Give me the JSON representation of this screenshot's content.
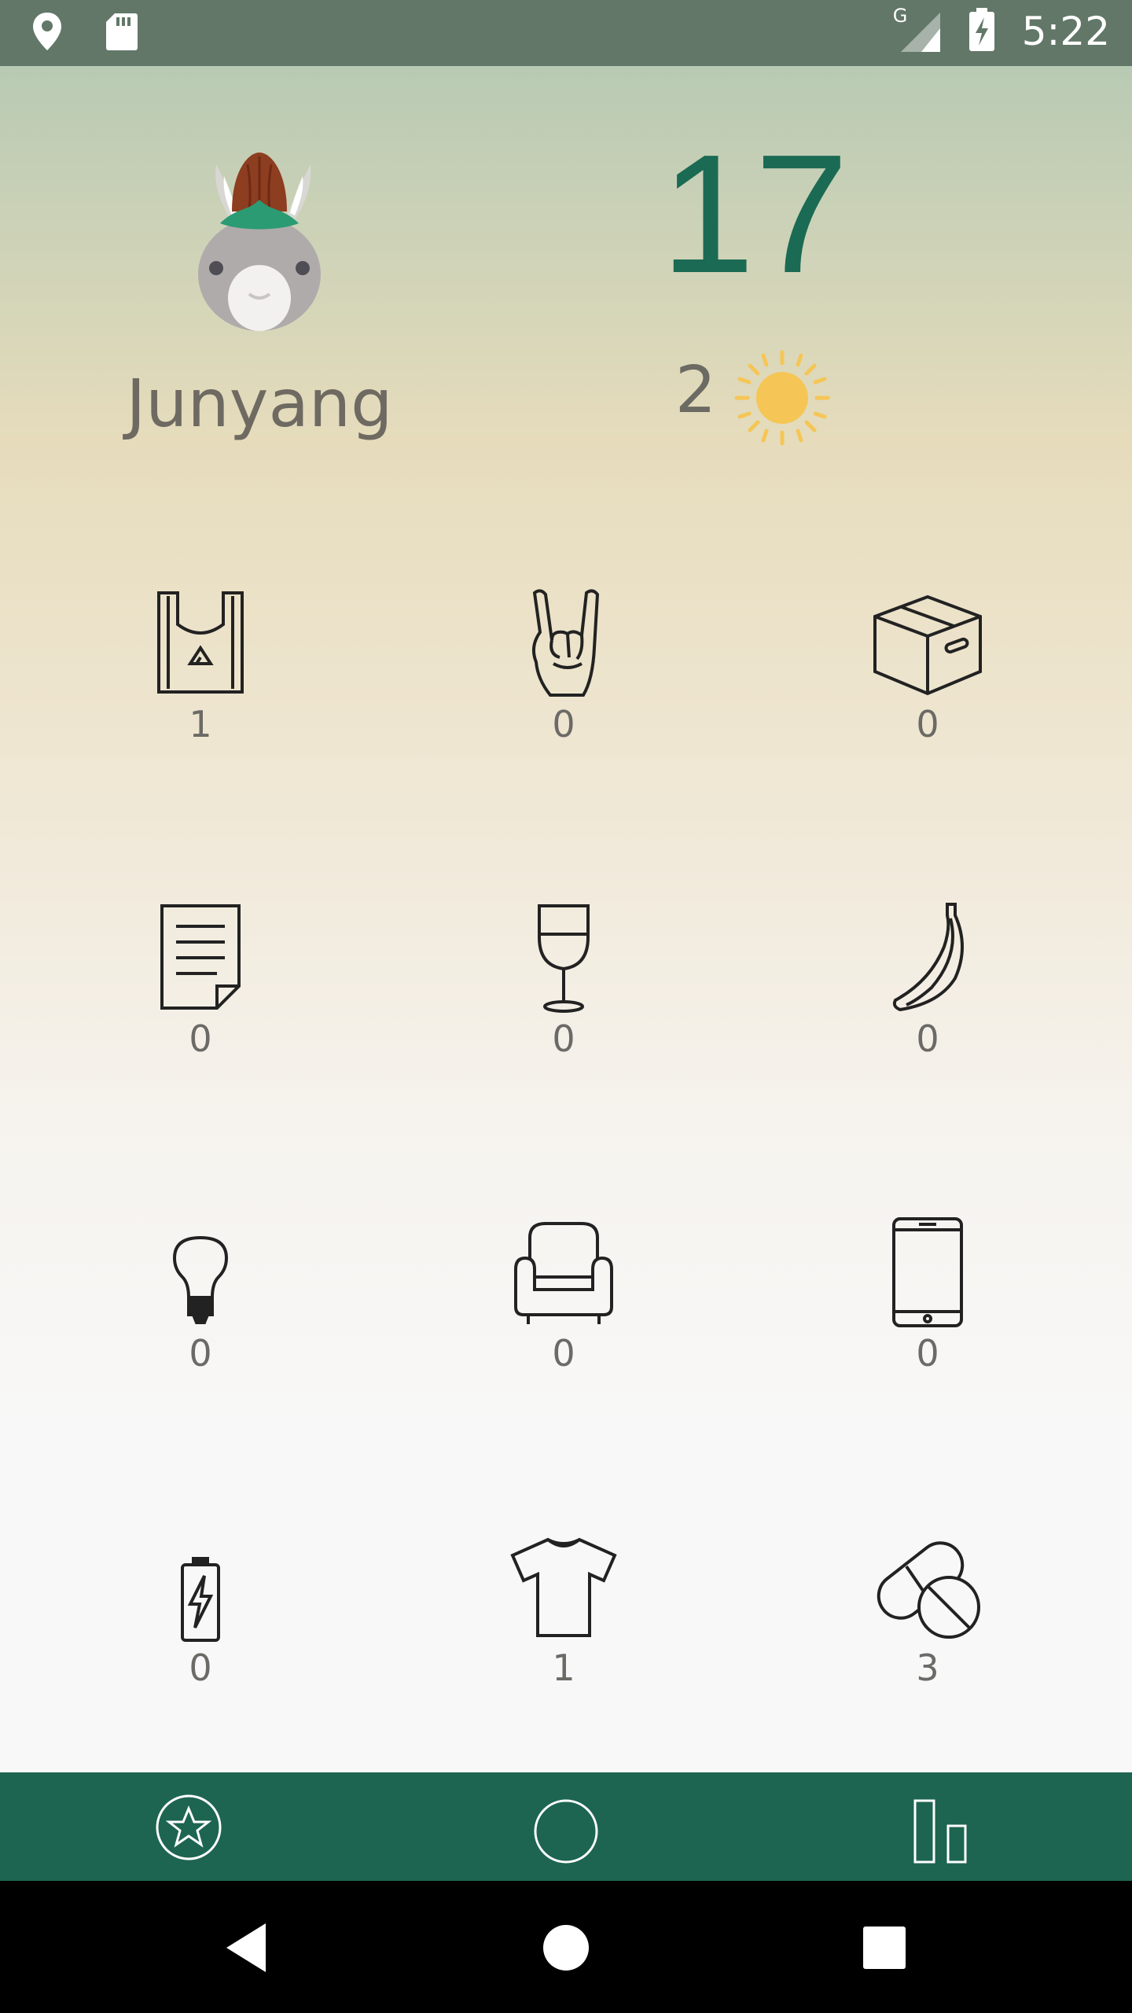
{
  "status_bar": {
    "time": "5:22",
    "network_label": "G",
    "left_icons": [
      "location-icon",
      "sd-card-icon"
    ],
    "right_icons": [
      "signal-icon",
      "battery-charging-icon"
    ]
  },
  "profile": {
    "username": "Junyang",
    "score": "17",
    "sun_count": "2",
    "avatar_icon": "rabbit-avatar-icon"
  },
  "items": [
    {
      "icon": "plastic-bag-icon",
      "count": "1"
    },
    {
      "icon": "rock-hand-icon",
      "count": "0"
    },
    {
      "icon": "cardboard-box-icon",
      "count": "0"
    },
    {
      "icon": "paper-document-icon",
      "count": "0"
    },
    {
      "icon": "wine-glass-icon",
      "count": "0"
    },
    {
      "icon": "banana-icon",
      "count": "0"
    },
    {
      "icon": "light-bulb-icon",
      "count": "0"
    },
    {
      "icon": "armchair-icon",
      "count": "0"
    },
    {
      "icon": "smartphone-icon",
      "count": "0"
    },
    {
      "icon": "battery-icon",
      "count": "0"
    },
    {
      "icon": "t-shirt-icon",
      "count": "1"
    },
    {
      "icon": "pills-icon",
      "count": "3"
    }
  ],
  "bottom_nav": [
    "star-badge-icon",
    "circle-home-icon",
    "bar-chart-icon"
  ],
  "system_nav": [
    "back-icon",
    "home-icon",
    "recents-icon"
  ],
  "colors": {
    "status_bar": "#627768",
    "accent_green": "#1d6550",
    "score_green": "#1b6a54",
    "text_gray": "#6e6a62"
  }
}
